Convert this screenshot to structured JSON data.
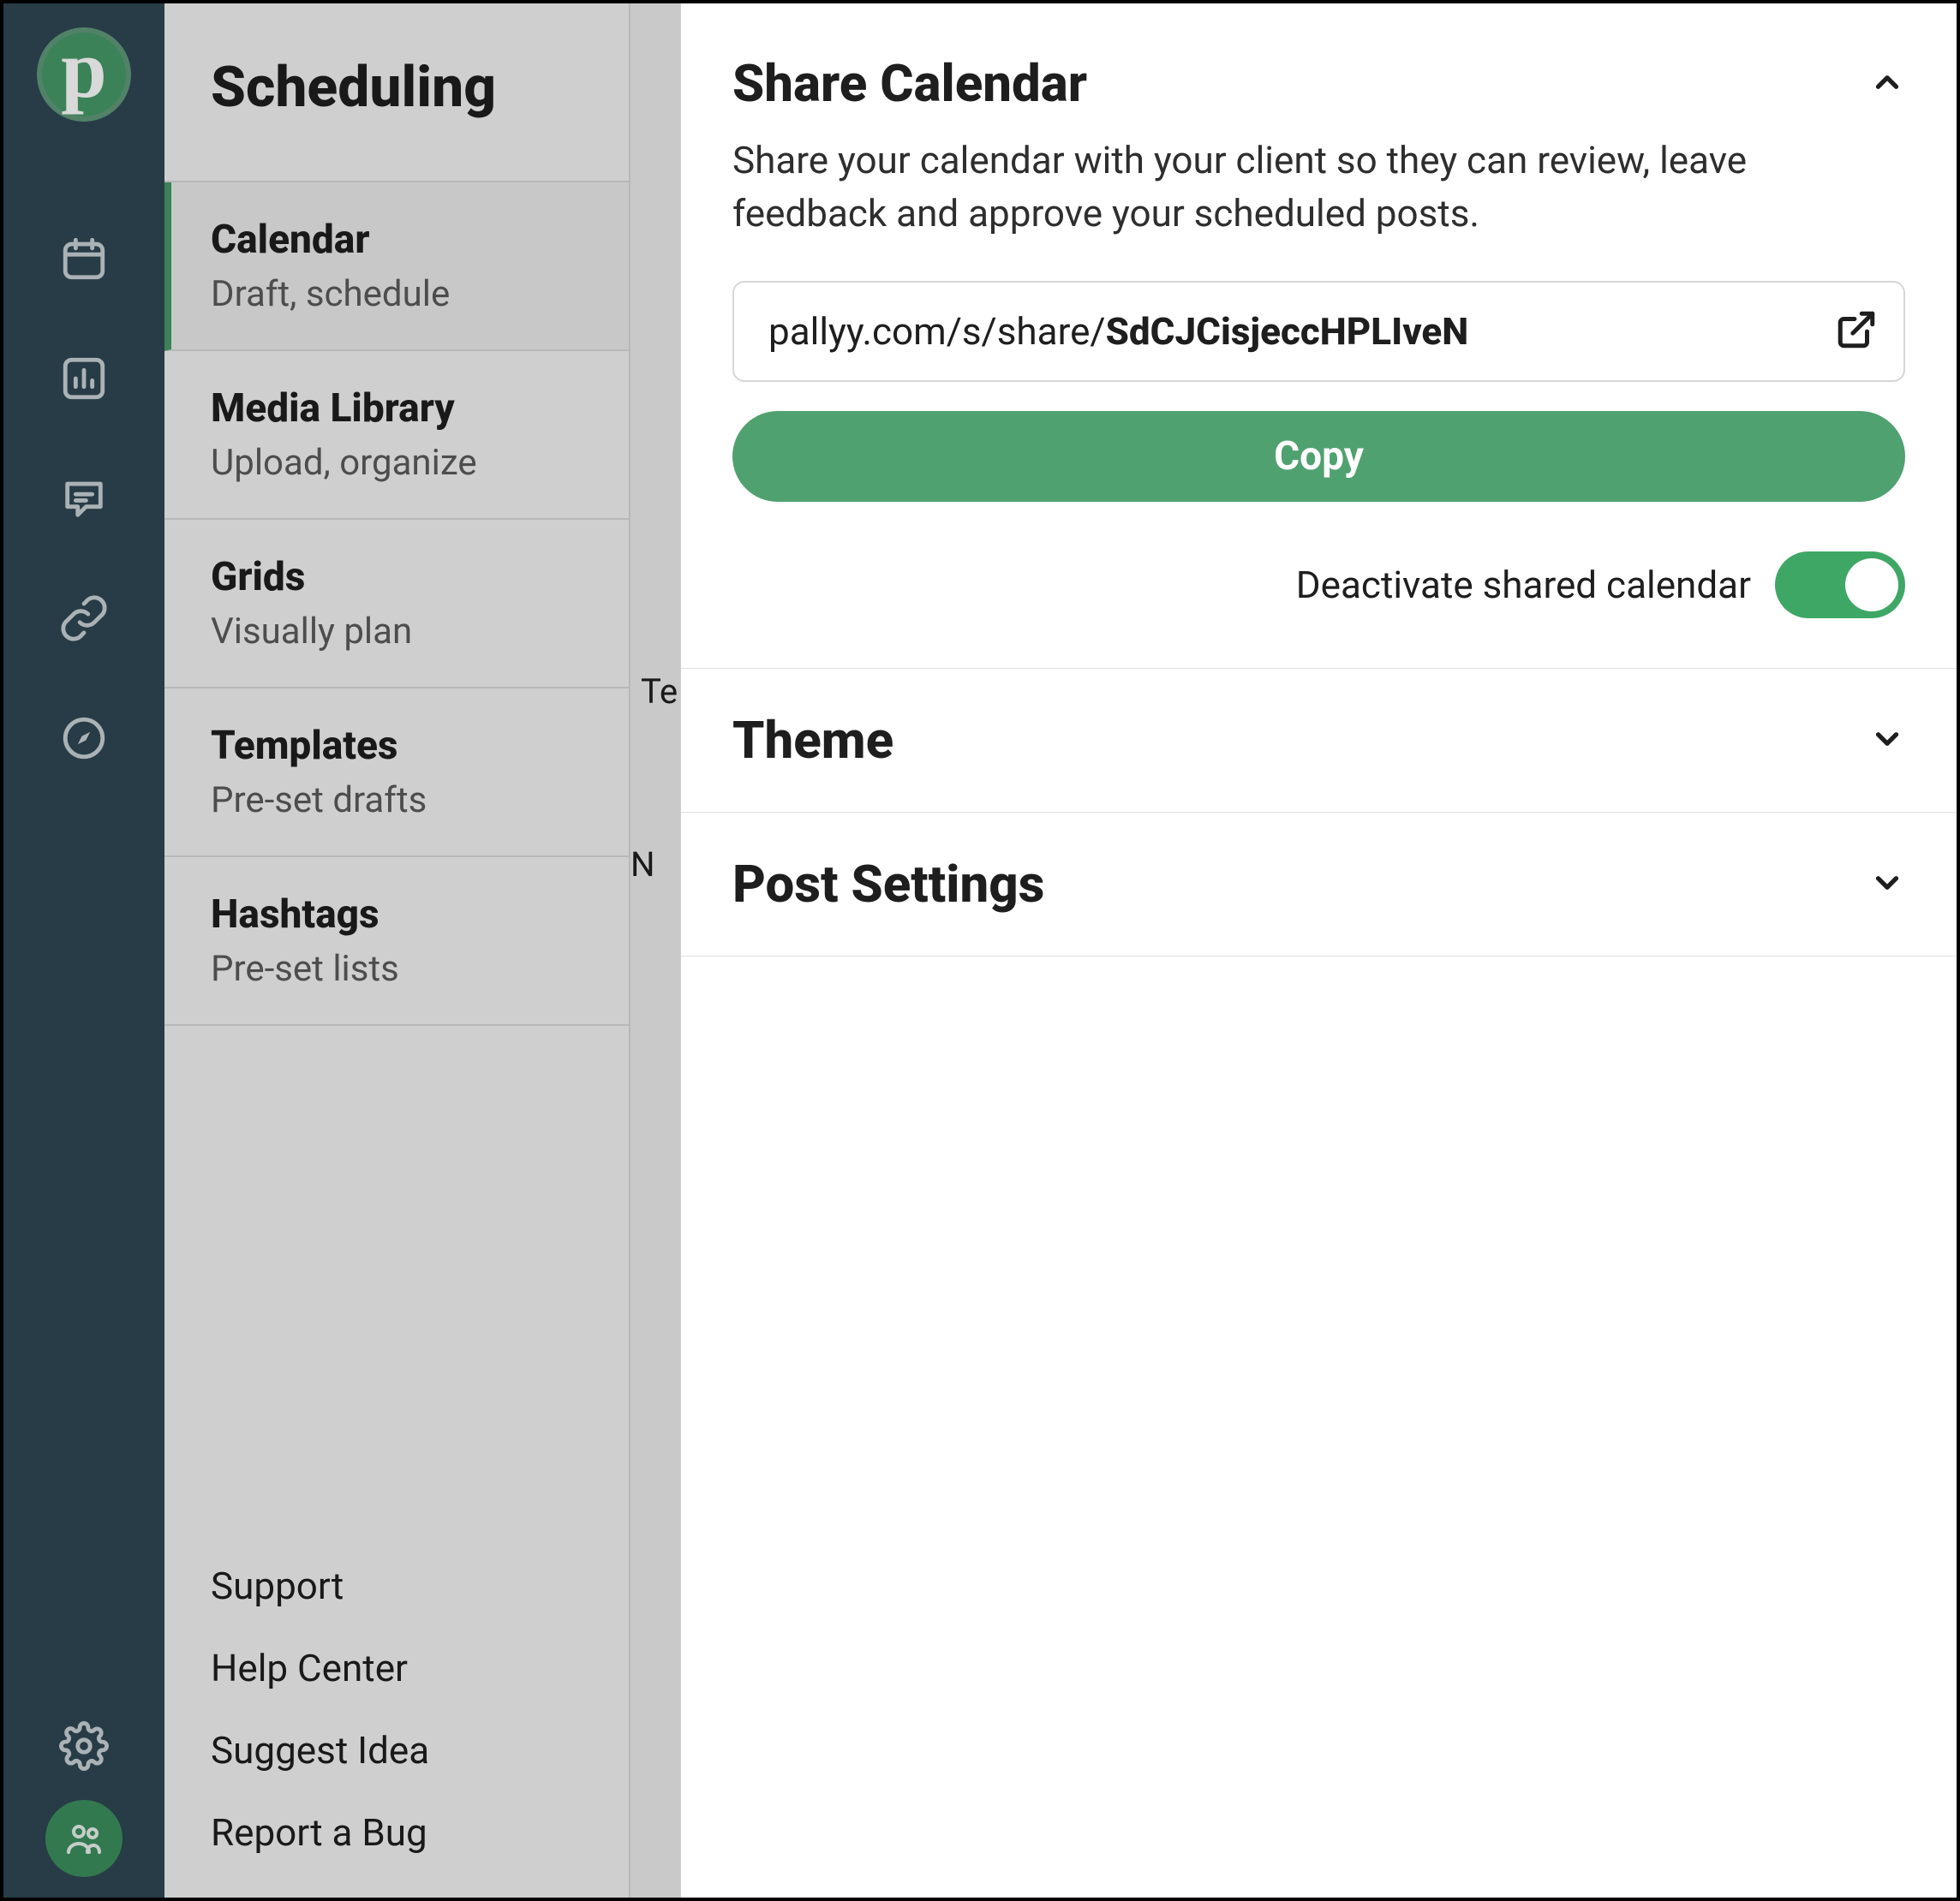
{
  "app": {
    "logo_letter": "p"
  },
  "sidebar": {
    "heading": "Scheduling",
    "items": [
      {
        "title": "Calendar",
        "subtitle": "Draft, schedule",
        "active": true
      },
      {
        "title": "Media Library",
        "subtitle": "Upload, organize"
      },
      {
        "title": "Grids",
        "subtitle": "Visually plan"
      },
      {
        "title": "Templates",
        "subtitle": "Pre-set drafts"
      },
      {
        "title": "Hashtags",
        "subtitle": "Pre-set lists"
      }
    ],
    "footer": [
      "Support",
      "Help Center",
      "Suggest Idea",
      "Report a Bug"
    ]
  },
  "obscured": {
    "hint1": "Te",
    "hint2": "N"
  },
  "panel": {
    "share": {
      "title": "Share Calendar",
      "description": "Share your calendar with your client so they can review, leave feedback and approve your scheduled posts.",
      "url_prefix": "pallyy.com/s/share/",
      "url_code": "SdCJCisjeccHPLIveN",
      "copy_label": "Copy",
      "deactivate_label": "Deactivate shared calendar",
      "toggle_on": true
    },
    "theme_title": "Theme",
    "post_settings_title": "Post Settings"
  }
}
